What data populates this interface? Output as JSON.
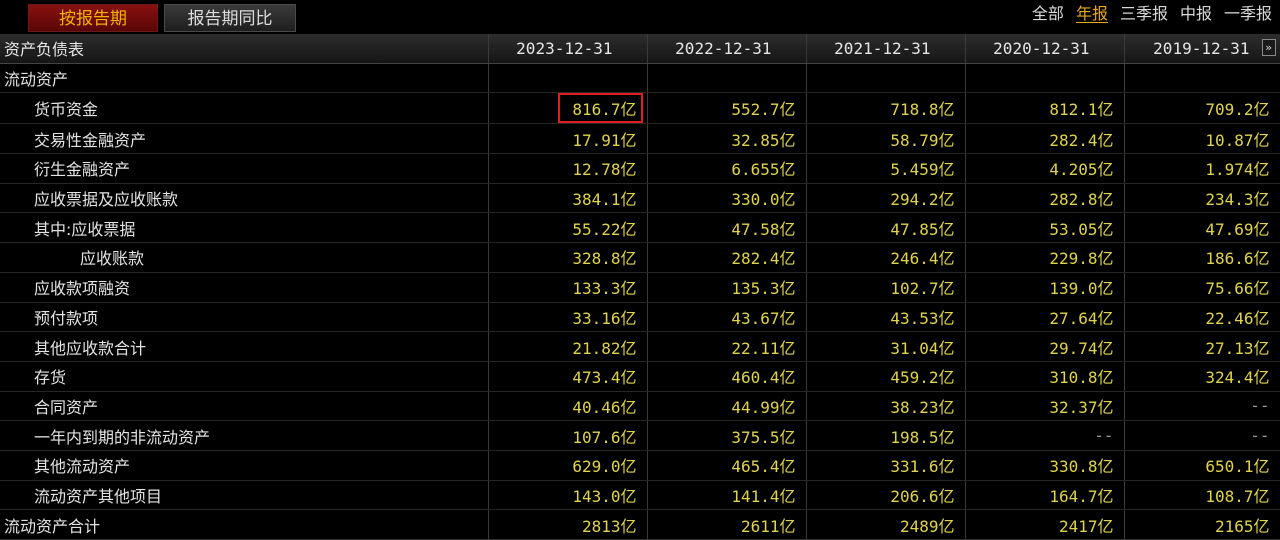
{
  "tabs": {
    "by_period": "按报告期",
    "period_yoy": "报告期同比"
  },
  "filters": [
    {
      "label": "全部",
      "active": false
    },
    {
      "label": "年报",
      "active": true
    },
    {
      "label": "三季报",
      "active": false
    },
    {
      "label": "中报",
      "active": false
    },
    {
      "label": "一季报",
      "active": false
    }
  ],
  "table": {
    "title": "资产负债表",
    "periods": [
      "2023-12-31",
      "2022-12-31",
      "2021-12-31",
      "2020-12-31",
      "2019-12-31"
    ],
    "unit": "亿",
    "scroll_icon": "double-chevron-right-icon",
    "rows": [
      {
        "label": "流动资产",
        "indent": 0,
        "type": "section",
        "values": [
          "",
          "",
          "",
          "",
          ""
        ]
      },
      {
        "label": "货币资金",
        "indent": 1,
        "values": [
          "816.7",
          "552.7",
          "718.8",
          "812.1",
          "709.2"
        ],
        "highlight_col": 0
      },
      {
        "label": "交易性金融资产",
        "indent": 1,
        "values": [
          "17.91",
          "32.85",
          "58.79",
          "282.4",
          "10.87"
        ]
      },
      {
        "label": "衍生金融资产",
        "indent": 1,
        "values": [
          "12.78",
          "6.655",
          "5.459",
          "4.205",
          "1.974"
        ]
      },
      {
        "label": "应收票据及应收账款",
        "indent": 1,
        "values": [
          "384.1",
          "330.0",
          "294.2",
          "282.8",
          "234.3"
        ]
      },
      {
        "label": "其中:应收票据",
        "indent": 1,
        "values": [
          "55.22",
          "47.58",
          "47.85",
          "53.05",
          "47.69"
        ]
      },
      {
        "label": "应收账款",
        "indent": 2,
        "values": [
          "328.8",
          "282.4",
          "246.4",
          "229.8",
          "186.6"
        ]
      },
      {
        "label": "应收款项融资",
        "indent": 1,
        "values": [
          "133.3",
          "135.3",
          "102.7",
          "139.0",
          "75.66"
        ]
      },
      {
        "label": "预付款项",
        "indent": 1,
        "values": [
          "33.16",
          "43.67",
          "43.53",
          "27.64",
          "22.46"
        ]
      },
      {
        "label": "其他应收款合计",
        "indent": 1,
        "values": [
          "21.82",
          "22.11",
          "31.04",
          "29.74",
          "27.13"
        ]
      },
      {
        "label": "存货",
        "indent": 1,
        "values": [
          "473.4",
          "460.4",
          "459.2",
          "310.8",
          "324.4"
        ]
      },
      {
        "label": "合同资产",
        "indent": 1,
        "values": [
          "40.46",
          "44.99",
          "38.23",
          "32.37",
          "--"
        ]
      },
      {
        "label": "一年内到期的非流动资产",
        "indent": 1,
        "values": [
          "107.6",
          "375.5",
          "198.5",
          "--",
          "--"
        ]
      },
      {
        "label": "其他流动资产",
        "indent": 1,
        "values": [
          "629.0",
          "465.4",
          "331.6",
          "330.8",
          "650.1"
        ]
      },
      {
        "label": "流动资产其他项目",
        "indent": 1,
        "values": [
          "143.0",
          "141.4",
          "206.6",
          "164.7",
          "108.7"
        ]
      },
      {
        "label": "流动资产合计",
        "indent": 0,
        "type": "total",
        "values": [
          "2813",
          "2611",
          "2489",
          "2417",
          "2165"
        ]
      }
    ]
  }
}
